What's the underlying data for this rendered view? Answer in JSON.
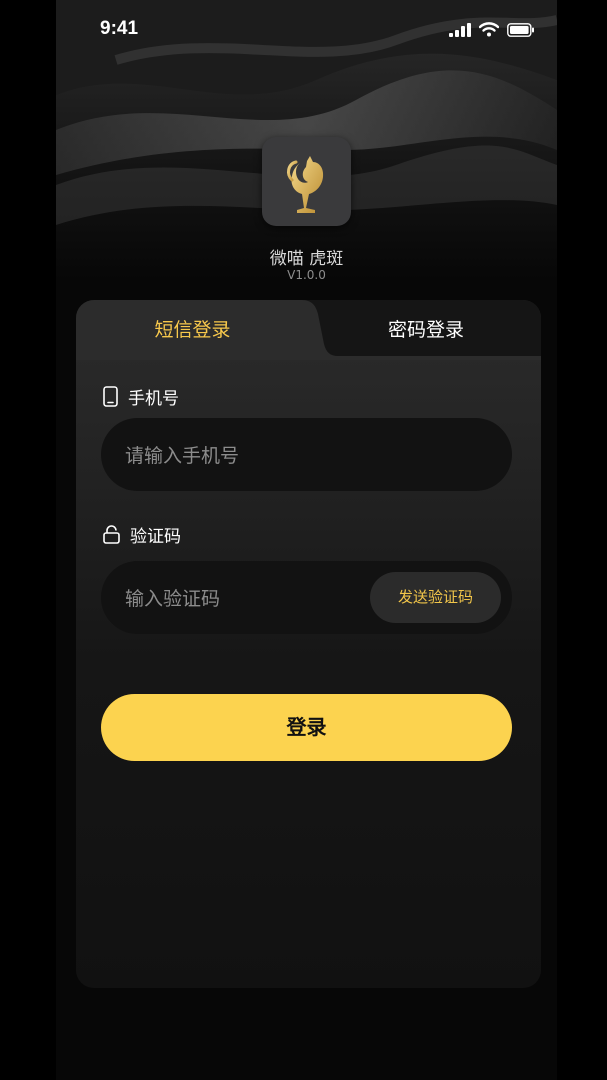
{
  "status_bar": {
    "time": "9:41"
  },
  "app": {
    "name": "微喵 虎斑",
    "version": "V1.0.0"
  },
  "tabs": [
    {
      "label": "短信登录",
      "active": true
    },
    {
      "label": "密码登录",
      "active": false
    }
  ],
  "form": {
    "phone": {
      "label": "手机号",
      "placeholder": "请输入手机号",
      "value": ""
    },
    "code": {
      "label": "验证码",
      "placeholder": "输入验证码",
      "value": "",
      "send_label": "发送验证码"
    },
    "submit_label": "登录"
  },
  "colors": {
    "accent": "#fcd34f",
    "active_tab_text": "#f8c94c",
    "background": "#070707"
  },
  "icons": [
    "signal-icon",
    "wifi-icon",
    "battery-icon",
    "cat-logo-icon",
    "phone-icon",
    "lock-icon"
  ]
}
